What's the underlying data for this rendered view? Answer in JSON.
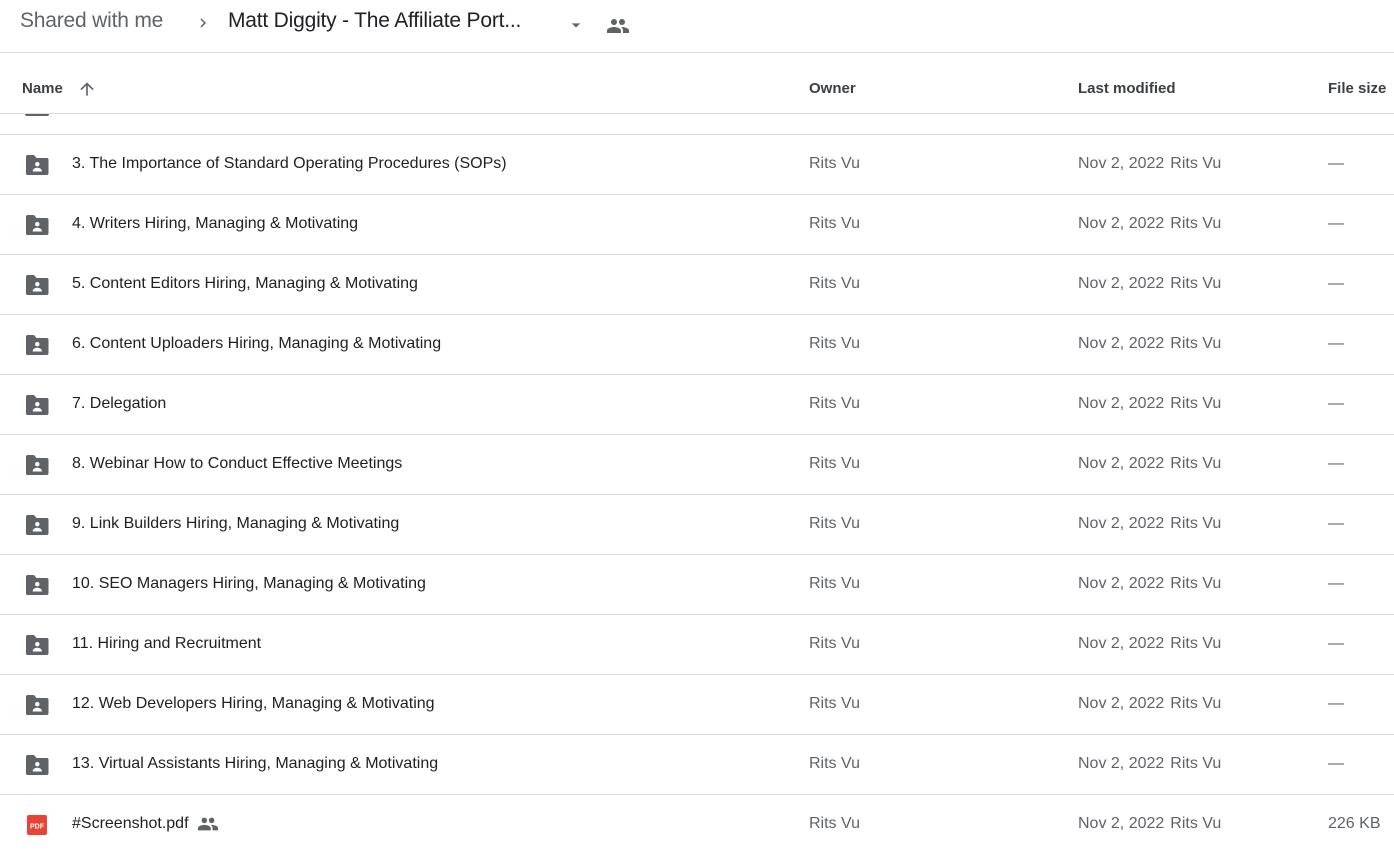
{
  "breadcrumb": {
    "root": "Shared with me",
    "separator_icon": "chevron-right-icon",
    "current": "Matt Diggity - The Affiliate Port...",
    "dropdown_icon": "arrow-drop-down-icon",
    "shared_icon": "people-icon"
  },
  "columns": {
    "name": "Name",
    "sort_icon": "arrow-upward-icon",
    "owner": "Owner",
    "last_modified": "Last modified",
    "file_size": "File size"
  },
  "rows": [
    {
      "name": "3. The Importance of Standard Operating Procedures (SOPs)",
      "type": "shared-folder",
      "owner": "Rits Vu",
      "modified_date": "Nov 2, 2022",
      "modified_by": "Rits Vu",
      "size": "—"
    },
    {
      "name": "4. Writers Hiring, Managing & Motivating",
      "type": "shared-folder",
      "owner": "Rits Vu",
      "modified_date": "Nov 2, 2022",
      "modified_by": "Rits Vu",
      "size": "—"
    },
    {
      "name": "5. Content Editors Hiring, Managing & Motivating",
      "type": "shared-folder",
      "owner": "Rits Vu",
      "modified_date": "Nov 2, 2022",
      "modified_by": "Rits Vu",
      "size": "—"
    },
    {
      "name": "6. Content Uploaders Hiring, Managing & Motivating",
      "type": "shared-folder",
      "owner": "Rits Vu",
      "modified_date": "Nov 2, 2022",
      "modified_by": "Rits Vu",
      "size": "—"
    },
    {
      "name": "7. Delegation",
      "type": "shared-folder",
      "owner": "Rits Vu",
      "modified_date": "Nov 2, 2022",
      "modified_by": "Rits Vu",
      "size": "—"
    },
    {
      "name": "8. Webinar How to Conduct Effective Meetings",
      "type": "shared-folder",
      "owner": "Rits Vu",
      "modified_date": "Nov 2, 2022",
      "modified_by": "Rits Vu",
      "size": "—"
    },
    {
      "name": "9. Link Builders Hiring, Managing & Motivating",
      "type": "shared-folder",
      "owner": "Rits Vu",
      "modified_date": "Nov 2, 2022",
      "modified_by": "Rits Vu",
      "size": "—"
    },
    {
      "name": "10. SEO Managers Hiring, Managing & Motivating",
      "type": "shared-folder",
      "owner": "Rits Vu",
      "modified_date": "Nov 2, 2022",
      "modified_by": "Rits Vu",
      "size": "—"
    },
    {
      "name": "11. Hiring and Recruitment",
      "type": "shared-folder",
      "owner": "Rits Vu",
      "modified_date": "Nov 2, 2022",
      "modified_by": "Rits Vu",
      "size": "—"
    },
    {
      "name": "12. Web Developers Hiring, Managing & Motivating",
      "type": "shared-folder",
      "owner": "Rits Vu",
      "modified_date": "Nov 2, 2022",
      "modified_by": "Rits Vu",
      "size": "—"
    },
    {
      "name": "13. Virtual Assistants Hiring, Managing & Motivating",
      "type": "shared-folder",
      "owner": "Rits Vu",
      "modified_date": "Nov 2, 2022",
      "modified_by": "Rits Vu",
      "size": "—"
    },
    {
      "name": "#Screenshot.pdf",
      "type": "pdf",
      "shared": true,
      "pdf_label": "PDF",
      "owner": "Rits Vu",
      "modified_date": "Nov 2, 2022",
      "modified_by": "Rits Vu",
      "size": "226 KB"
    }
  ],
  "colors": {
    "icon_gray": "#5f6368",
    "pdf_red": "#ea4335",
    "divider": "#dadce0",
    "text_primary": "#202124",
    "text_secondary": "#5f6368"
  }
}
